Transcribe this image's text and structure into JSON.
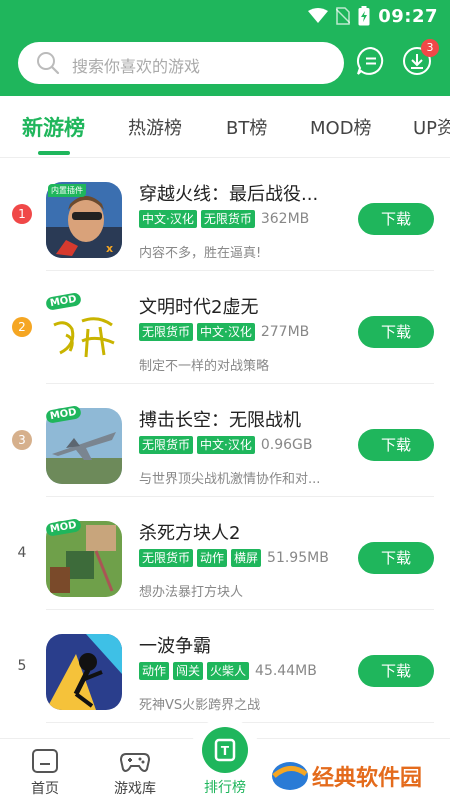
{
  "status_bar": {
    "time": "09:27"
  },
  "search": {
    "placeholder": "搜索你喜欢的游戏"
  },
  "header": {
    "download_badge": "3"
  },
  "tabs": [
    {
      "label": "新游榜",
      "active": true
    },
    {
      "label": "热游榜"
    },
    {
      "label": "BT榜"
    },
    {
      "label": "MOD榜"
    },
    {
      "label": "UP资"
    }
  ],
  "games": [
    {
      "rank": "1",
      "rank_color": "#f04848",
      "name": "穿越火线：最后战役...",
      "icon_badge": "内置插件",
      "tags": [
        "中文·汉化",
        "无限货币"
      ],
      "size": "362MB",
      "desc": "内容不多，胜在逼真!",
      "button": "下载"
    },
    {
      "rank": "2",
      "rank_color": "#f5a623",
      "name": "文明时代2虚无",
      "icon_badge": "MOD",
      "tags": [
        "无限货币",
        "中文·汉化"
      ],
      "size": "277MB",
      "desc": "制定不一样的对战策略",
      "button": "下载"
    },
    {
      "rank": "3",
      "rank_color": "#d6b08c",
      "name": "搏击长空：无限战机",
      "icon_badge": "MOD",
      "tags": [
        "无限货币",
        "中文·汉化"
      ],
      "size": "0.96GB",
      "desc": "与世界顶尖战机激情协作和对...",
      "button": "下载"
    },
    {
      "rank": "4",
      "rank_color": "",
      "name": "杀死方块人2",
      "icon_badge": "MOD",
      "tags": [
        "无限货币",
        "动作",
        "横屏"
      ],
      "size": "51.95MB",
      "desc": "想办法暴打方块人",
      "button": "下载"
    },
    {
      "rank": "5",
      "rank_color": "",
      "name": "一波争霸",
      "icon_badge": "",
      "tags": [
        "动作",
        "闯关",
        "火柴人"
      ],
      "size": "45.44MB",
      "desc": "死神VS火影跨界之战",
      "button": "下载"
    }
  ],
  "bottom_nav": [
    {
      "label": "首页",
      "icon": "home-icon"
    },
    {
      "label": "游戏库",
      "icon": "gamepad-icon"
    },
    {
      "label": "排行榜",
      "icon": "ranking-icon",
      "active": true
    }
  ],
  "watermark": {
    "text": "经典软件园"
  },
  "colors": {
    "brand": "#1fb65c",
    "badge": "#f04848"
  }
}
